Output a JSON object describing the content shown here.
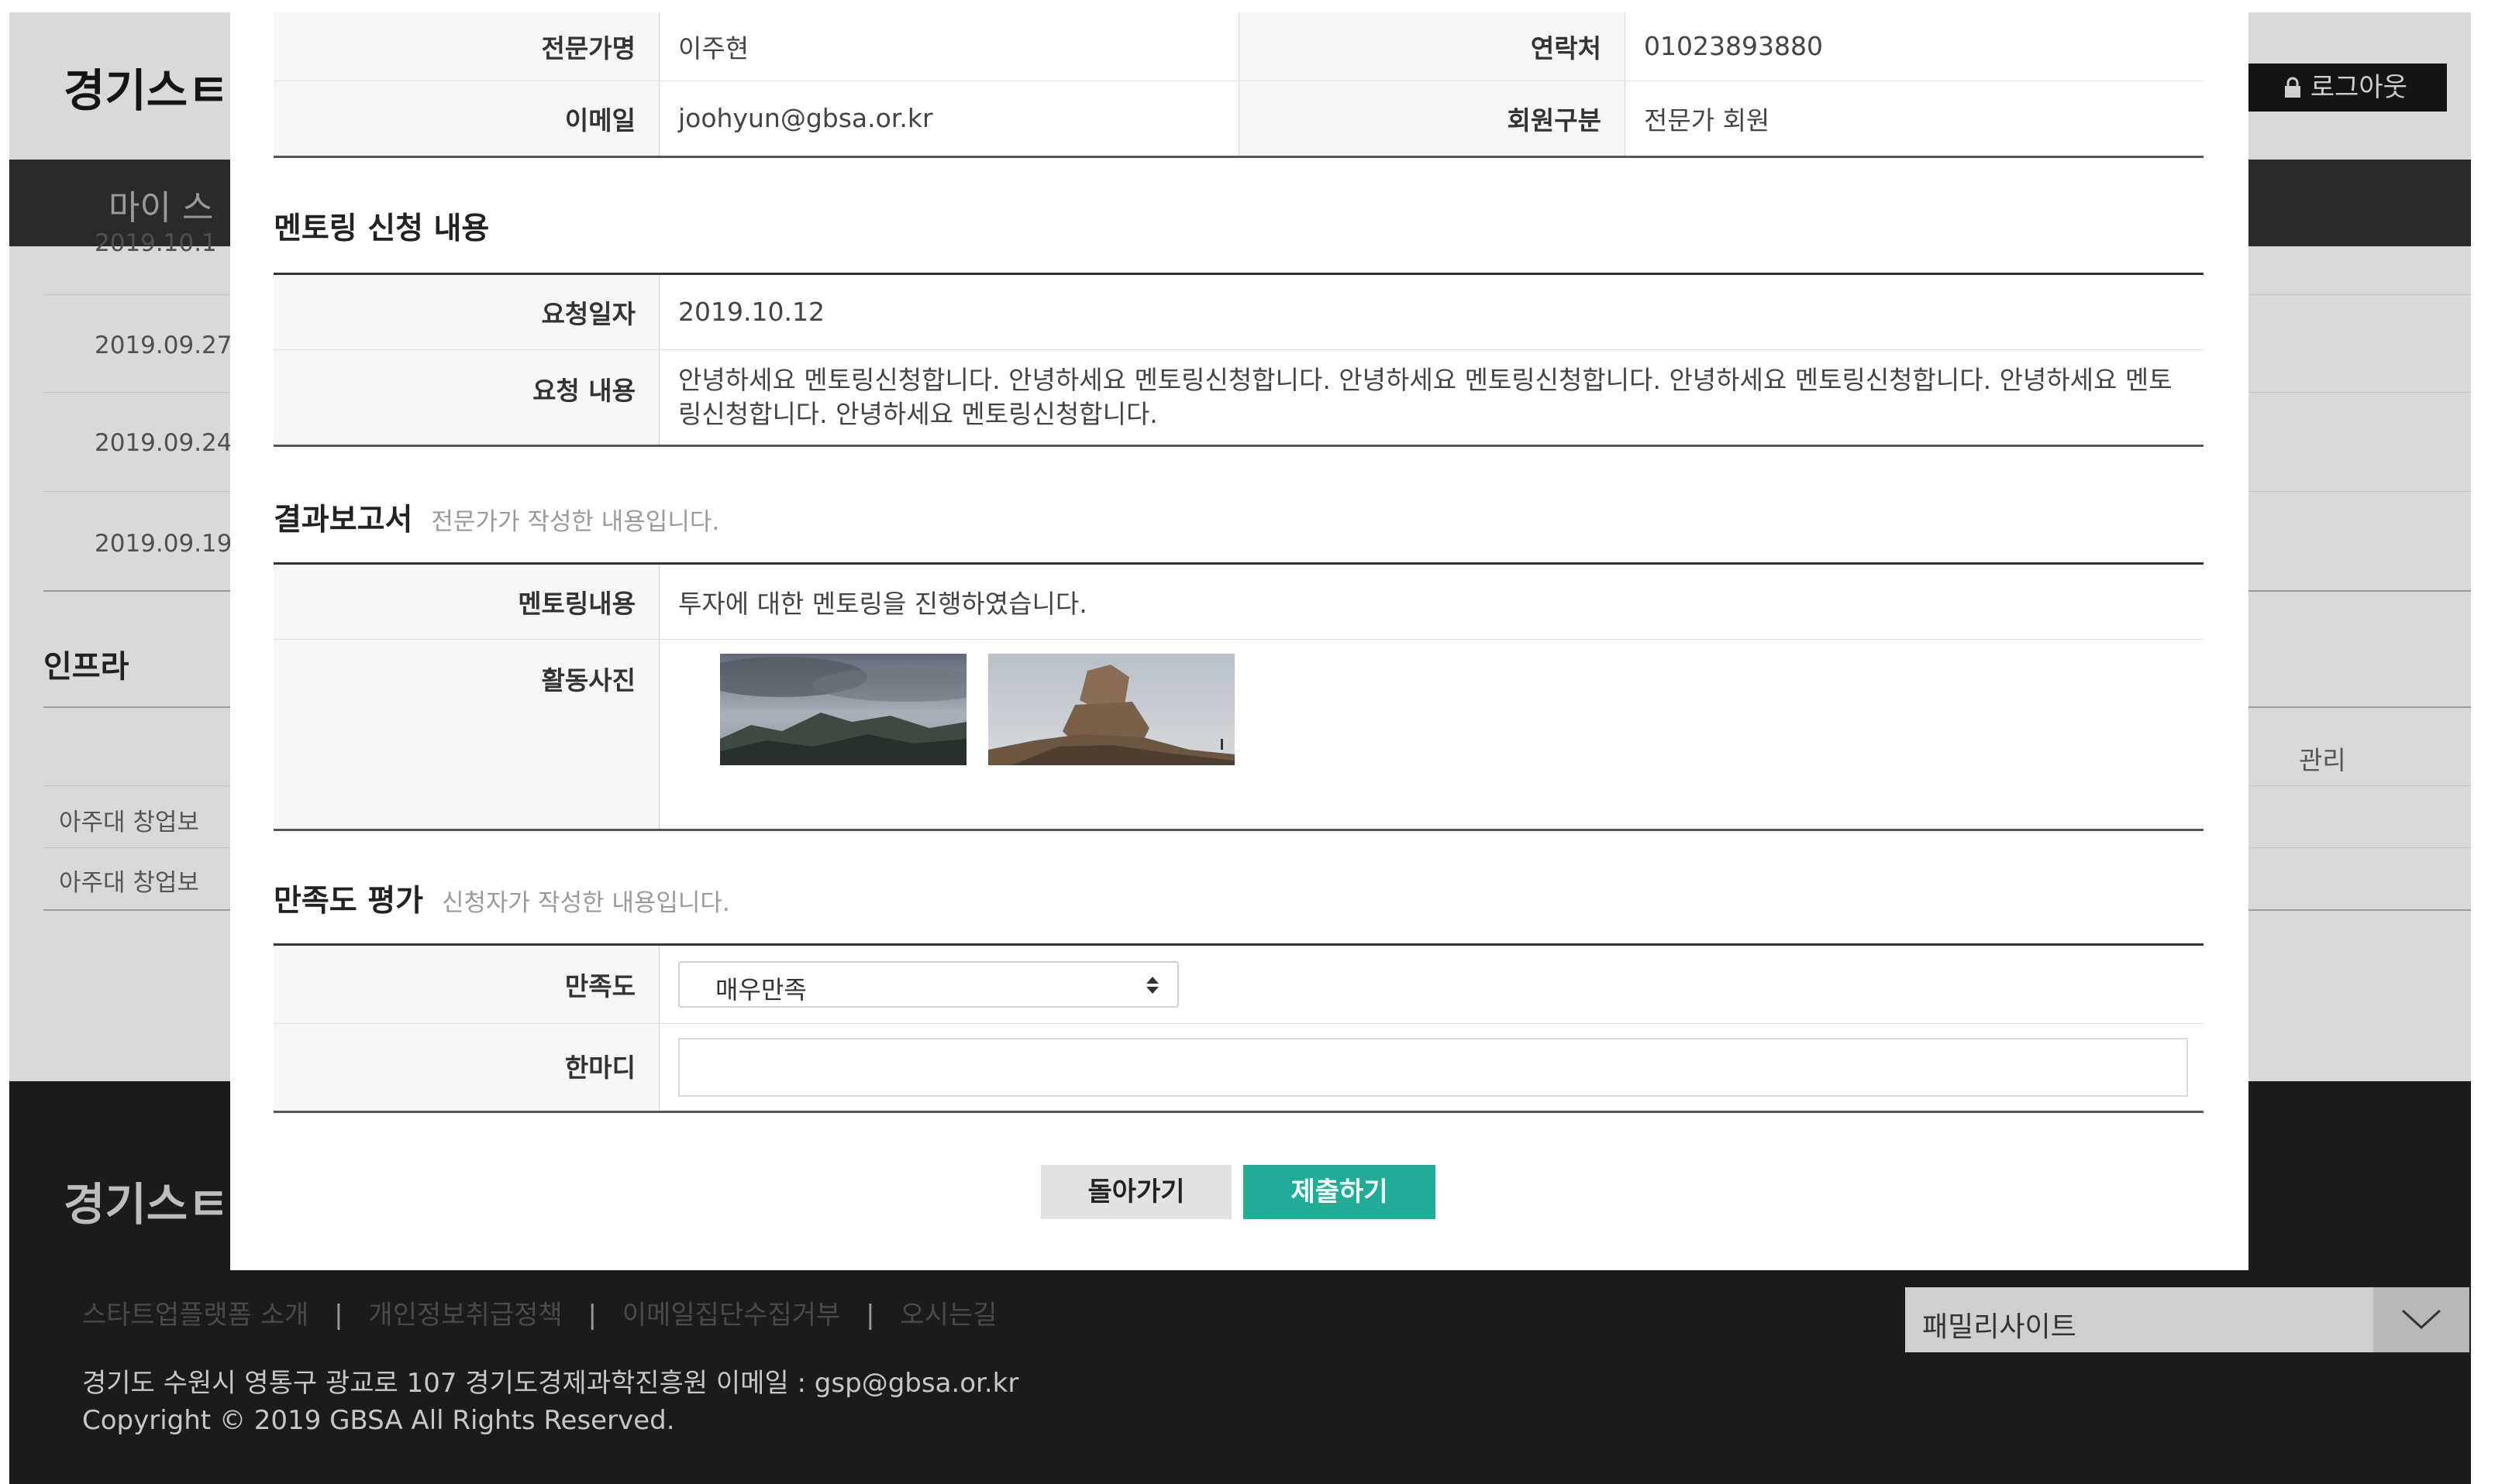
{
  "background": {
    "logo": "경기스ㅌ",
    "logout_label": "로그아웃",
    "nav_item": "마이 스",
    "dates": [
      "2019.10.1",
      "2019.09.27",
      "2019.09.24",
      "2019.09.19"
    ],
    "section_infra": "인프라",
    "manage_header": "관리",
    "rows": [
      "아주대 창업보",
      "아주대 창업보"
    ],
    "footer": {
      "logo": "경기스ㅌ",
      "links": [
        "스타트업플랫폼 소개",
        "개인정보취급정책",
        "이메일집단수집거부",
        "오시는길"
      ],
      "separator": "|",
      "address": "경기도 수원시 영통구 광교로 107 경기도경제과학진흥원 이메일 : gsp@gbsa.or.kr",
      "copyright": "Copyright © 2019 GBSA All Rights Reserved.",
      "family_site": "패밀리사이트"
    }
  },
  "modal": {
    "expert_info": {
      "name_label": "전문가명",
      "name_value": "이주현",
      "contact_label": "연락처",
      "contact_value": "01023893880",
      "email_label": "이메일",
      "email_value": "joohyun@gbsa.or.kr",
      "member_label": "회원구분",
      "member_value": "전문가 회원"
    },
    "request": {
      "title": "멘토링 신청 내용",
      "date_label": "요청일자",
      "date_value": "2019.10.12",
      "content_label": "요청 내용",
      "content_value": "안녕하세요 멘토링신청합니다. 안녕하세요 멘토링신청합니다. 안녕하세요 멘토링신청합니다. 안녕하세요 멘토링신청합니다. 안녕하세요 멘토링신청합니다. 안녕하세요 멘토링신청합니다."
    },
    "report": {
      "title": "결과보고서",
      "hint": "전문가가 작성한 내용입니다.",
      "content_label": "멘토링내용",
      "content_value": "투자에 대한 멘토링을 진행하였습니다.",
      "photos_label": "활동사진"
    },
    "satisfaction": {
      "title": "만족도 평가",
      "hint": "신청자가 작성한 내용입니다.",
      "rating_label": "만족도",
      "rating_value": "매우만족",
      "comment_label": "한마디",
      "comment_value": ""
    },
    "buttons": {
      "back": "돌아가기",
      "submit": "제출하기"
    }
  },
  "colors": {
    "submit_button": "#1fae95",
    "dark_nav": "#2a2a2a",
    "footer": "#1b1b1b"
  },
  "icons": [
    "lock-icon",
    "chevron-down-icon",
    "select-arrows-icon"
  ]
}
